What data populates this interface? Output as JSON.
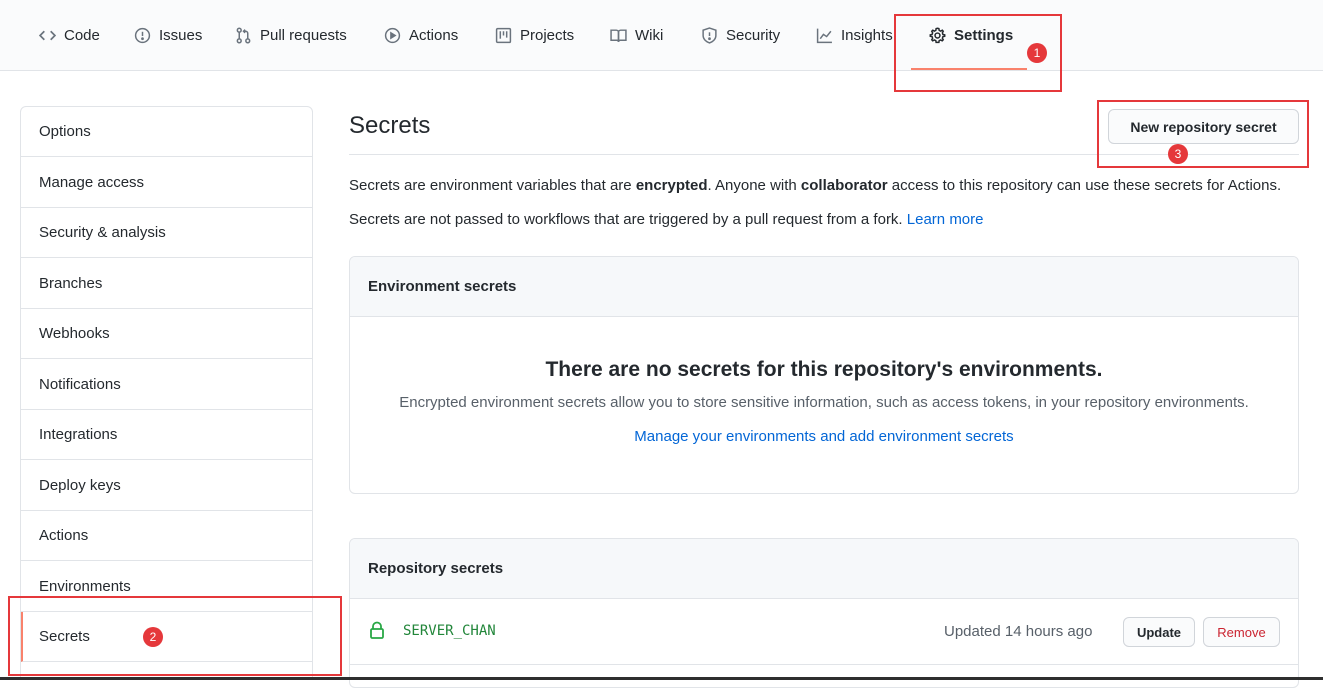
{
  "tabs": [
    {
      "label": "Code",
      "icon": "code-icon"
    },
    {
      "label": "Issues",
      "icon": "issue-opened-icon"
    },
    {
      "label": "Pull requests",
      "icon": "git-pull-request-icon"
    },
    {
      "label": "Actions",
      "icon": "play-icon"
    },
    {
      "label": "Projects",
      "icon": "project-icon"
    },
    {
      "label": "Wiki",
      "icon": "book-icon"
    },
    {
      "label": "Security",
      "icon": "shield-icon"
    },
    {
      "label": "Insights",
      "icon": "graph-icon"
    },
    {
      "label": "Settings",
      "icon": "gear-icon",
      "selected": true
    }
  ],
  "annotations": {
    "badge1": "1",
    "badge2": "2",
    "badge3": "3",
    "color": "#e5383b"
  },
  "sidebar": {
    "items": [
      {
        "label": "Options"
      },
      {
        "label": "Manage access"
      },
      {
        "label": "Security & analysis"
      },
      {
        "label": "Branches"
      },
      {
        "label": "Webhooks"
      },
      {
        "label": "Notifications"
      },
      {
        "label": "Integrations"
      },
      {
        "label": "Deploy keys"
      },
      {
        "label": "Actions"
      },
      {
        "label": "Environments"
      },
      {
        "label": "Secrets",
        "active": true
      }
    ]
  },
  "main": {
    "title": "Secrets",
    "new_secret_button": "New repository secret",
    "intro": {
      "part1": "Secrets are environment variables that are ",
      "bold1": "encrypted",
      "part2": ". Anyone with ",
      "bold2": "collaborator",
      "part3": " access to this repository can use these secrets for Actions."
    },
    "fork_note": "Secrets are not passed to workflows that are triggered by a pull request from a fork.",
    "learn_more": "Learn more",
    "environment_secrets": {
      "header": "Environment secrets",
      "blank_title": "There are no secrets for this repository's environments.",
      "blank_desc": "Encrypted environment secrets allow you to store sensitive information, such as access tokens, in your repository environments.",
      "manage_link": "Manage your environments and add environment secrets"
    },
    "repository_secrets": {
      "header": "Repository secrets",
      "rows": [
        {
          "name": "SERVER_CHAN",
          "updated": "Updated 14 hours ago",
          "update_label": "Update",
          "remove_label": "Remove",
          "icon": "lock-icon"
        }
      ]
    }
  },
  "colors": {
    "accent": "#f9826c",
    "link": "#0366d6",
    "secret_name": "#22863a",
    "danger": "#cb2431",
    "lock": "#28a745"
  }
}
